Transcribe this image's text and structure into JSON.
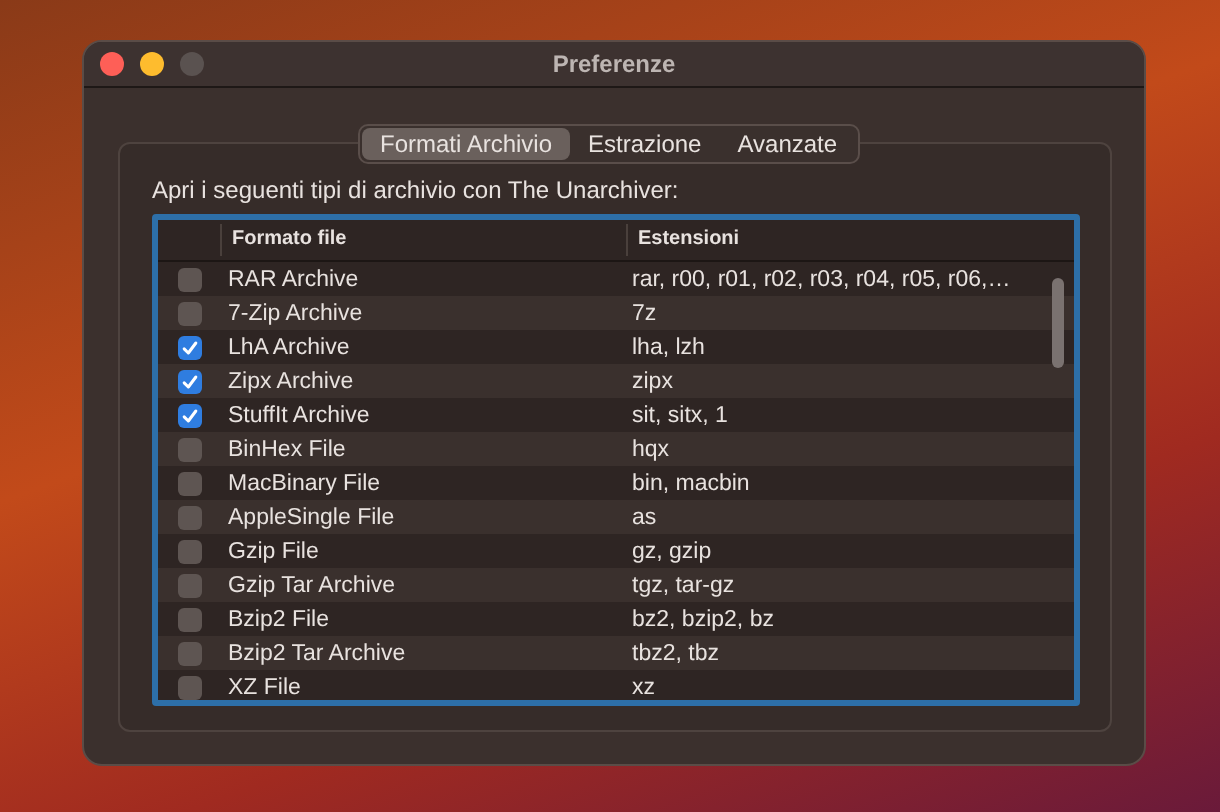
{
  "window": {
    "title": "Preferenze"
  },
  "tabs": [
    {
      "label": "Formati Archivio",
      "selected": true
    },
    {
      "label": "Estrazione",
      "selected": false
    },
    {
      "label": "Avanzate",
      "selected": false
    }
  ],
  "intro": "Apri i seguenti tipi di archivio con The Unarchiver:",
  "table": {
    "columns": [
      "Formato file",
      "Estensioni"
    ],
    "rows": [
      {
        "format": "RAR Archive",
        "extensions": "rar, r00, r01, r02, r03, r04, r05, r06,…",
        "checked": false
      },
      {
        "format": "7-Zip Archive",
        "extensions": "7z",
        "checked": false
      },
      {
        "format": "LhA Archive",
        "extensions": "lha, lzh",
        "checked": true
      },
      {
        "format": "Zipx Archive",
        "extensions": "zipx",
        "checked": true
      },
      {
        "format": "StuffIt Archive",
        "extensions": "sit, sitx, 1",
        "checked": true
      },
      {
        "format": "BinHex File",
        "extensions": "hqx",
        "checked": false
      },
      {
        "format": "MacBinary File",
        "extensions": "bin, macbin",
        "checked": false
      },
      {
        "format": "AppleSingle File",
        "extensions": "as",
        "checked": false
      },
      {
        "format": "Gzip File",
        "extensions": "gz, gzip",
        "checked": false
      },
      {
        "format": "Gzip Tar Archive",
        "extensions": "tgz, tar-gz",
        "checked": false
      },
      {
        "format": "Bzip2 File",
        "extensions": "bz2, bzip2, bz",
        "checked": false
      },
      {
        "format": "Bzip2 Tar Archive",
        "extensions": "tbz2, tbz",
        "checked": false
      },
      {
        "format": "XZ File",
        "extensions": "xz",
        "checked": false
      }
    ]
  }
}
